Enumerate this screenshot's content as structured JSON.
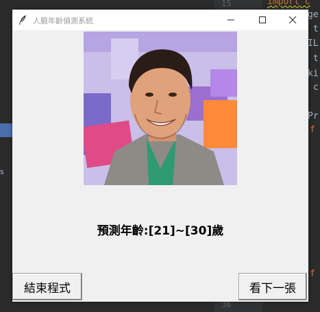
{
  "window": {
    "title": "人臉年齡偵測系統",
    "prediction": "預測年齡:[21]~[30]歲",
    "buttons": {
      "quit": "結束程式",
      "next": "看下一張"
    }
  },
  "background_ide": {
    "line_numbers": [
      "15",
      "36"
    ],
    "code_lines": [
      "import c",
      "ge",
      "t",
      "IL",
      "t",
      "ki",
      "c",
      "Pr",
      "f",
      "f"
    ],
    "left_panel_label": "s"
  }
}
